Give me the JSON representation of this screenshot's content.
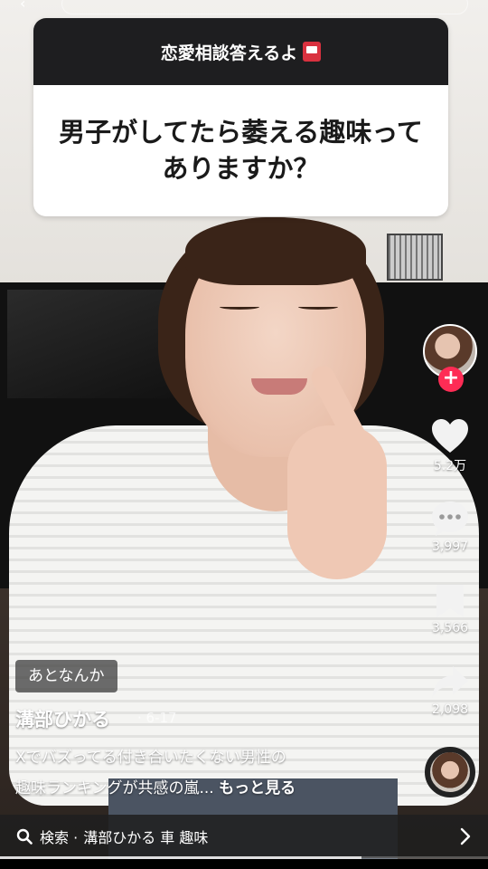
{
  "question_card": {
    "header": "恋愛相談答えるよ",
    "header_icon": "mailbox-icon",
    "question_line1": "男子がしてたら萎える趣味って",
    "question_line2": "ありますか？"
  },
  "actions": {
    "like_count": "5.2万",
    "comment_count": "3,997",
    "save_count": "3,566",
    "share_count": "2,098"
  },
  "video_info": {
    "tag_chip": "あとなんか",
    "author": "溝部ひかる",
    "date": "· 6-17",
    "desc_line1": "Xでバズってる付き合いたくない男性の",
    "desc_line2": "趣味ランキングが共感の嵐...",
    "more_label": "もっと見る"
  },
  "search_bar": {
    "prefix": "検索 ·",
    "query": "溝部ひかる 車 趣味"
  },
  "progress": {
    "fraction": 0.74
  },
  "colors": {
    "follow_badge": "#fe2c55",
    "card_header_bg": "#1e1e20"
  }
}
